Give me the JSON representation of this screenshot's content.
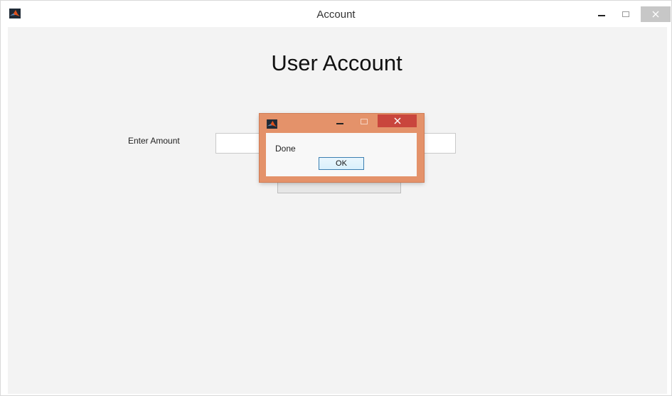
{
  "window": {
    "title": "Account",
    "icon": "matlab-icon",
    "controls": {
      "minimize_glyph": "–",
      "maximize_glyph": "▭",
      "close_glyph": "✕"
    }
  },
  "form": {
    "heading": "User Account",
    "amount_label": "Enter Amount",
    "amount_value": "",
    "submit_label": ""
  },
  "dialog": {
    "title": "",
    "icon": "matlab-icon",
    "message": "Done",
    "ok_label": "OK",
    "colors": {
      "frame": "#e4926a",
      "close": "#c9463d"
    }
  },
  "colors": {
    "window_bg": "#f3f3f3",
    "titlebar_bg": "#ffffff"
  }
}
